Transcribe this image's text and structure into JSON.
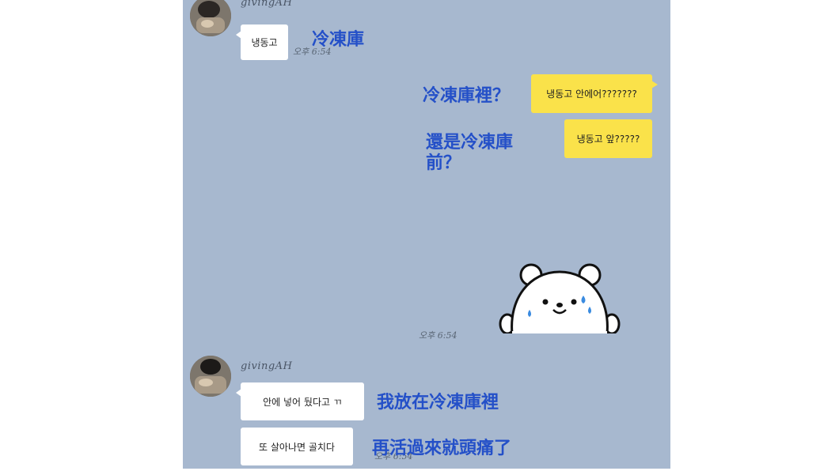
{
  "chat": {
    "background_color": "#a7b8cf",
    "incoming_bubble_color": "#ffffff",
    "outgoing_bubble_color": "#fae24a",
    "annotation_color": "#2450c8",
    "groups": [
      {
        "sender": "givingAH",
        "messages": [
          {
            "text": "냉동고",
            "time": "오후 6:54"
          }
        ]
      },
      {
        "sender": "givingAH",
        "messages": [
          {
            "text": "안에 넣어 뒀다고 ㄲ"
          },
          {
            "text": "또 살아나면 골치다",
            "time": "오후 6:54"
          }
        ]
      }
    ],
    "outgoing": [
      {
        "text": "냉동고 안에어???????"
      },
      {
        "text": "냉동고 앞?????"
      }
    ],
    "sticker": {
      "icon": "bear-sticker-icon",
      "time": "오후 6:54"
    }
  },
  "annotations": {
    "freezer": "冷凍庫",
    "in_freezer_question": "冷凍庫裡？",
    "front_line1": "還是冷凍庫",
    "front_line2": "前？",
    "put_in_freezer": "我放在冷凍庫裡",
    "headache": "再活過來就頭痛了"
  }
}
